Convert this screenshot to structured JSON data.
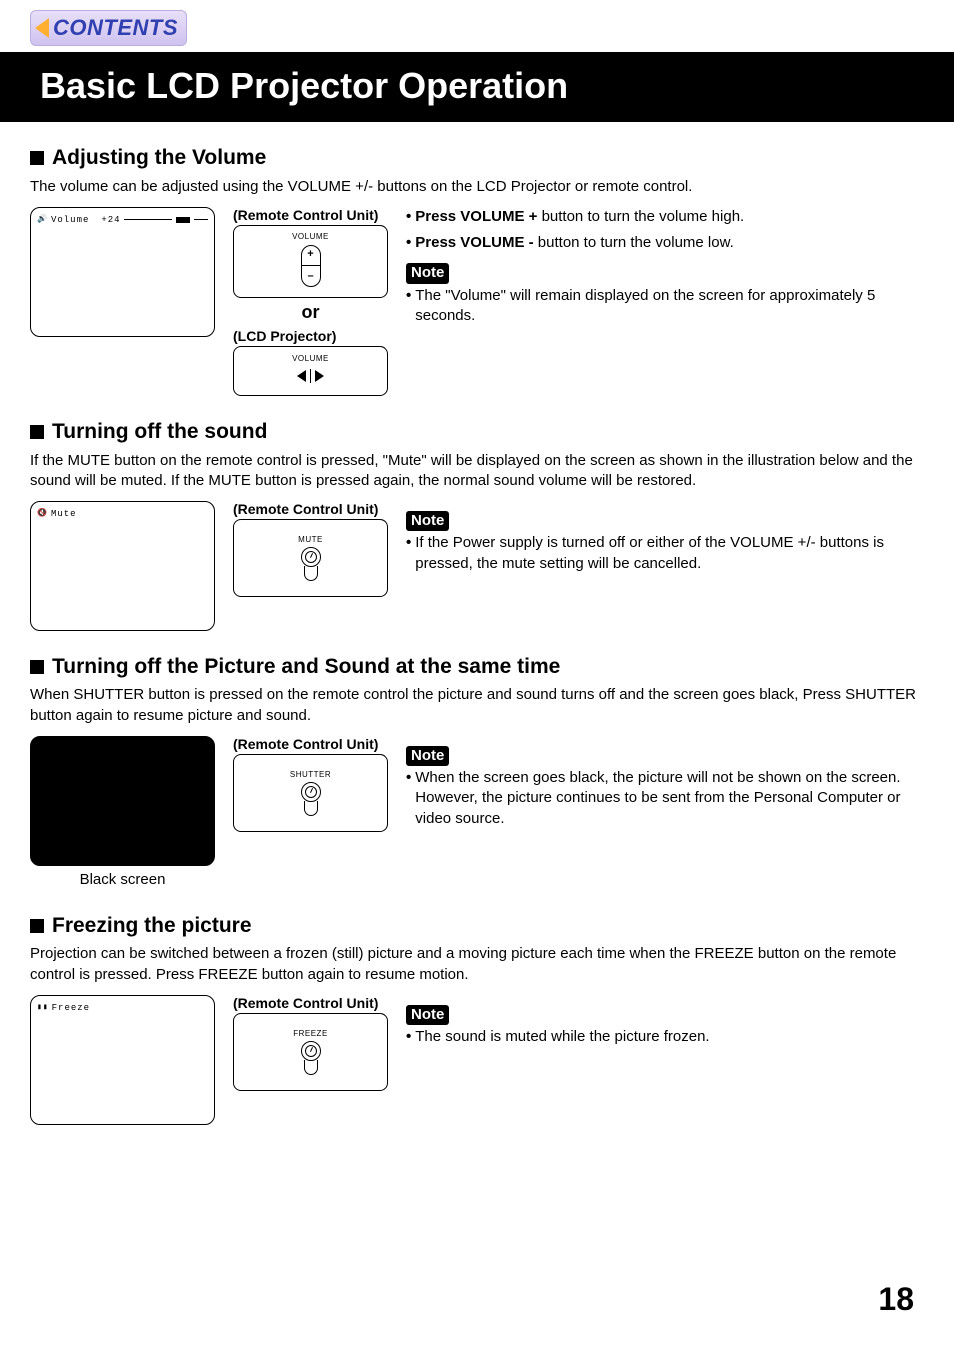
{
  "nav": {
    "contents_label": "CONTENTS"
  },
  "title": "Basic LCD Projector Operation",
  "page_number": "18",
  "labels": {
    "remote_control_unit": "(Remote Control Unit)",
    "lcd_projector": "(LCD Projector)",
    "or": "or",
    "note": "Note",
    "volume_btn": "VOLUME",
    "mute_btn": "MUTE",
    "shutter_btn": "SHUTTER",
    "freeze_btn": "FREEZE",
    "plus": "+",
    "minus": "–"
  },
  "sections": {
    "volume": {
      "heading": "Adjusting the Volume",
      "intro": "The volume can be adjusted using the VOLUME +/- buttons on the LCD Projector or remote control.",
      "osd_label": "Volume",
      "osd_value": "+24",
      "bullet1_bold": "Press VOLUME +",
      "bullet1_rest": " button to turn the volume high.",
      "bullet2_bold": "Press VOLUME  -",
      "bullet2_rest": " button to turn the volume low.",
      "note": "The \"Volume\" will remain displayed on the screen for approximately 5 seconds."
    },
    "mute": {
      "heading": "Turning off the sound",
      "intro": "If the MUTE button on the remote control is pressed, \"Mute\" will be displayed on the screen as shown in the illustration below and the sound will be muted. If the MUTE button is pressed again,  the normal sound volume will be restored.",
      "osd_label": "Mute",
      "note": "If the Power supply is turned off or either of the VOLUME +/- buttons is pressed, the mute setting will be cancelled."
    },
    "shutter": {
      "heading": "Turning off the Picture and Sound at the same time",
      "intro": "When SHUTTER button is pressed on the remote control the picture and sound turns off and the screen goes black, Press SHUTTER button again to resume picture and sound.",
      "caption": "Black screen",
      "note": "When the screen goes black, the picture will not be shown on the screen. However, the picture continues to be sent from the Personal Computer or video source."
    },
    "freeze": {
      "heading": "Freezing the picture",
      "intro": "Projection can be switched between a frozen (still) picture and a moving picture each time when the FREEZE button on the remote control is pressed. Press FREEZE button again to resume motion.",
      "osd_label": "Freeze",
      "note": "The sound is muted while the picture frozen."
    }
  }
}
